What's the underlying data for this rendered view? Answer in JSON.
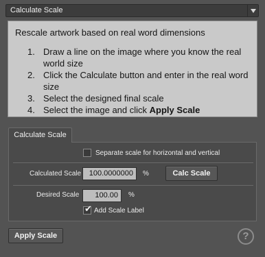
{
  "dropdown": {
    "selected": "Calculate Scale"
  },
  "instructions": {
    "intro": "Rescale artwork based on real word dimensions",
    "steps": [
      {
        "num": "1.",
        "text": "Draw a line on the image where you know the real world size"
      },
      {
        "num": "2.",
        "text": "Click the Calculate button and enter in the real word size"
      },
      {
        "num": "3.",
        "text": "Select the designed final scale"
      },
      {
        "num": "4.",
        "text_prefix": "Select the image and click ",
        "text_bold": "Apply Scale"
      }
    ]
  },
  "tab": {
    "label": "Calculate Scale"
  },
  "panel": {
    "separate_scale_label": "Separate scale for horizontal and vertical",
    "separate_scale_checked": false,
    "calculated_scale_label": "Calculated Scale",
    "calculated_scale_value": "100.0000000",
    "calculated_scale_unit": "%",
    "calc_button": "Calc Scale",
    "desired_scale_label": "Desired Scale",
    "desired_scale_value": "100.00",
    "desired_scale_unit": "%",
    "add_label_label": "Add Scale Label",
    "add_label_checked": true,
    "checkmark": "✔"
  },
  "footer": {
    "apply_button": "Apply Scale",
    "help_glyph": "?"
  }
}
